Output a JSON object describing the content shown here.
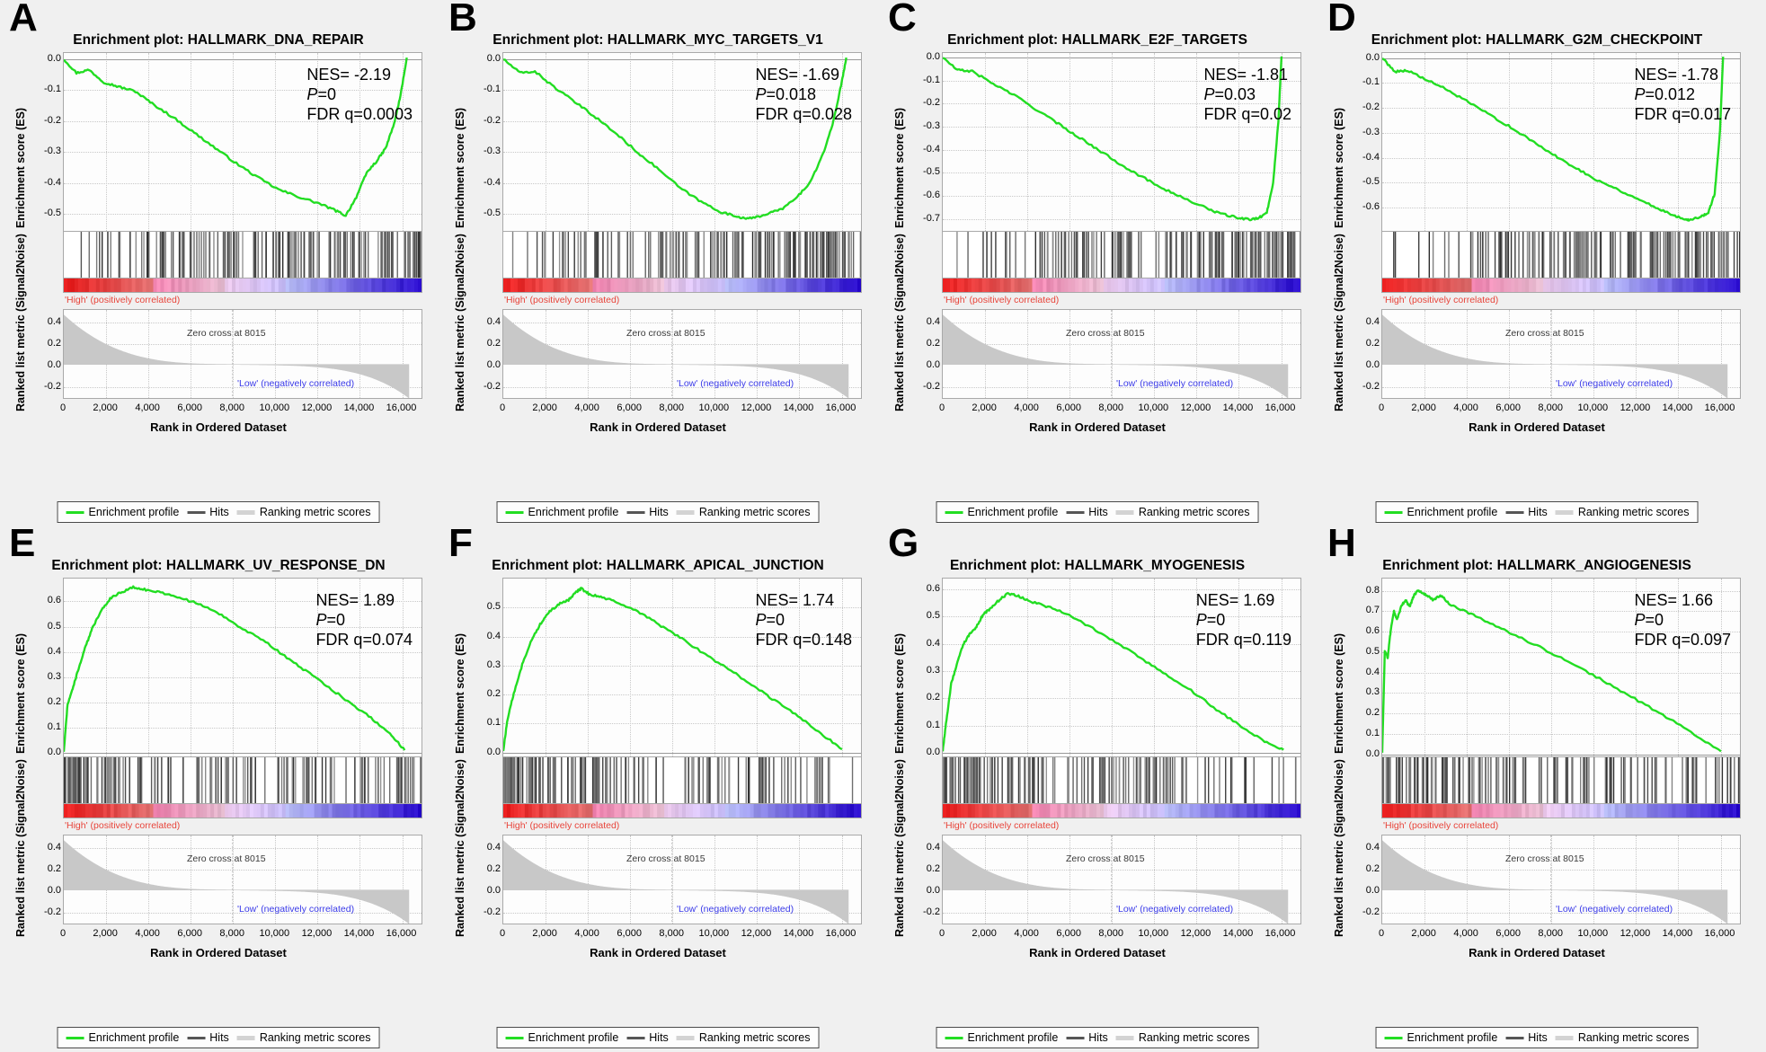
{
  "figure": {
    "background": "#f0f0f0",
    "curve_color": "#22dd22",
    "rank_fill": "#c8c8c8",
    "high_color": "#e8443a",
    "low_color": "#3a3ae8",
    "rows": 2,
    "cols": 4
  },
  "common": {
    "title_prefix": "Enrichment plot: ",
    "ylabel_es": "Enrichment score (ES)",
    "ylabel_rank": "Ranked list metric (Signal2Noise)",
    "xlabel": "Rank in Ordered Dataset",
    "high_label": "'High' (positively correlated)",
    "low_label": "'Low' (negatively correlated)",
    "zero_cross_label": "Zero cross at 8015",
    "zero_cross_rank": 8015,
    "xticks": [
      "0",
      "2,000",
      "4,000",
      "6,000",
      "8,000",
      "10,000",
      "12,000",
      "14,000",
      "16,000"
    ],
    "xtick_values": [
      0,
      2000,
      4000,
      6000,
      8000,
      10000,
      12000,
      14000,
      16000
    ],
    "xlim": [
      0,
      17000
    ],
    "metric_yticks": [
      "0.4",
      "0.2",
      "0.0",
      "-0.2"
    ],
    "metric_ylim": [
      -0.32,
      0.52
    ],
    "legend": {
      "enrichment_profile": "Enrichment profile",
      "hits": "Hits",
      "ranking_metric_scores": "Ranking metric scores"
    }
  },
  "panels": [
    {
      "letter": "A",
      "gene_set": "HALLMARK_DNA_REPAIR",
      "title": "Enrichment plot: HALLMARK_DNA_REPAIR",
      "nes_label": "NES= -2.19",
      "p_prefix": "P",
      "p_label": "=0",
      "fdr_label": "FDR q=0.0003",
      "nes": -2.19,
      "pvalue": 0,
      "fdr_q": 0.0003,
      "direction": "negative",
      "es_yticks": [
        "0.0",
        "-0.1",
        "-0.2",
        "-0.3",
        "-0.4",
        "-0.5"
      ],
      "es_ylim": [
        -0.56,
        0.02
      ],
      "peak_es": -0.51,
      "peak_rank": 13400,
      "chart_data": {
        "type": "line",
        "title": "Enrichment plot: HALLMARK_DNA_REPAIR",
        "xlabel": "Rank in Ordered Dataset",
        "ylabel": "Enrichment score (ES)",
        "xlim": [
          0,
          17000
        ],
        "ylim": [
          -0.56,
          0.02
        ],
        "grid": true,
        "x": [
          0,
          600,
          1200,
          1900,
          2600,
          3400,
          4200,
          5200,
          6200,
          7200,
          8200,
          9200,
          10200,
          11200,
          12100,
          12800,
          13400,
          13900,
          14400,
          14900,
          15300,
          15700,
          16000,
          16300
        ],
        "y": [
          0.0,
          -0.045,
          -0.035,
          -0.075,
          -0.09,
          -0.105,
          -0.145,
          -0.19,
          -0.24,
          -0.29,
          -0.34,
          -0.385,
          -0.425,
          -0.45,
          -0.47,
          -0.49,
          -0.51,
          -0.45,
          -0.37,
          -0.33,
          -0.29,
          -0.21,
          -0.12,
          0.005
        ]
      }
    },
    {
      "letter": "B",
      "gene_set": "HALLMARK_MYC_TARGETS_V1",
      "title": "Enrichment plot: HALLMARK_MYC_TARGETS_V1",
      "nes_label": "NES= -1.69",
      "p_prefix": "P",
      "p_label": "=0.018",
      "fdr_label": "FDR q=0.028",
      "nes": -1.69,
      "pvalue": 0.018,
      "fdr_q": 0.028,
      "direction": "negative",
      "es_yticks": [
        "0.0",
        "-0.1",
        "-0.2",
        "-0.3",
        "-0.4",
        "-0.5"
      ],
      "es_ylim": [
        -0.56,
        0.02
      ],
      "peak_es": -0.52,
      "peak_rank": 11800,
      "chart_data": {
        "type": "line",
        "title": "Enrichment plot: HALLMARK_MYC_TARGETS_V1",
        "xlabel": "Rank in Ordered Dataset",
        "ylabel": "Enrichment score (ES)",
        "xlim": [
          0,
          17000
        ],
        "ylim": [
          -0.56,
          0.02
        ],
        "grid": true,
        "x": [
          0,
          800,
          1500,
          2400,
          3400,
          4400,
          5400,
          6400,
          7400,
          8400,
          9400,
          10400,
          11200,
          11800,
          12500,
          13200,
          13900,
          14600,
          15200,
          15700,
          16100,
          16300
        ],
        "y": [
          0.0,
          -0.045,
          -0.04,
          -0.09,
          -0.14,
          -0.19,
          -0.245,
          -0.305,
          -0.36,
          -0.42,
          -0.465,
          -0.5,
          -0.515,
          -0.52,
          -0.505,
          -0.49,
          -0.455,
          -0.4,
          -0.31,
          -0.2,
          -0.07,
          0.005
        ]
      }
    },
    {
      "letter": "C",
      "gene_set": "HALLMARK_E2F_TARGETS",
      "title": "Enrichment plot: HALLMARK_E2F_TARGETS",
      "nes_label": "NES= -1.81",
      "p_prefix": "P",
      "p_label": "=0.03",
      "fdr_label": "FDR q=0.02",
      "nes": -1.81,
      "pvalue": 0.03,
      "fdr_q": 0.02,
      "direction": "negative",
      "es_yticks": [
        "0.0",
        "-0.1",
        "-0.2",
        "-0.3",
        "-0.4",
        "-0.5",
        "-0.6",
        "-0.7"
      ],
      "es_ylim": [
        -0.76,
        0.02
      ],
      "peak_es": -0.71,
      "peak_rank": 14500,
      "chart_data": {
        "type": "line",
        "title": "Enrichment plot: HALLMARK_E2F_TARGETS",
        "xlabel": "Rank in Ordered Dataset",
        "ylabel": "Enrichment score (ES)",
        "xlim": [
          0,
          17000
        ],
        "ylim": [
          -0.76,
          0.02
        ],
        "grid": true,
        "x": [
          0,
          700,
          1400,
          2400,
          3400,
          4400,
          5400,
          6400,
          7400,
          8400,
          9400,
          10400,
          11400,
          12400,
          13200,
          13900,
          14500,
          15000,
          15400,
          15700,
          15950,
          16100
        ],
        "y": [
          0.0,
          -0.055,
          -0.06,
          -0.115,
          -0.165,
          -0.225,
          -0.285,
          -0.345,
          -0.405,
          -0.465,
          -0.52,
          -0.57,
          -0.615,
          -0.655,
          -0.685,
          -0.7,
          -0.71,
          -0.705,
          -0.68,
          -0.55,
          -0.28,
          0.005
        ]
      }
    },
    {
      "letter": "D",
      "gene_set": "HALLMARK_G2M_CHECKPOINT",
      "title": "Enrichment plot: HALLMARK_G2M_CHECKPOINT",
      "nes_label": "NES= -1.78",
      "p_prefix": "P",
      "p_label": "=0.012",
      "fdr_label": "FDR q=0.017",
      "nes": -1.78,
      "pvalue": 0.012,
      "fdr_q": 0.017,
      "direction": "negative",
      "es_yticks": [
        "0.0",
        "-0.1",
        "-0.2",
        "-0.3",
        "-0.4",
        "-0.5",
        "-0.6"
      ],
      "es_ylim": [
        -0.7,
        0.02
      ],
      "peak_es": -0.655,
      "peak_rank": 14600,
      "chart_data": {
        "type": "line",
        "title": "Enrichment plot: HALLMARK_G2M_CHECKPOINT",
        "xlabel": "Rank in Ordered Dataset",
        "ylabel": "Enrichment score (ES)",
        "xlim": [
          0,
          17000
        ],
        "ylim": [
          -0.7,
          0.02
        ],
        "grid": true,
        "x": [
          0,
          600,
          1200,
          2000,
          3000,
          4000,
          5000,
          6000,
          7000,
          8000,
          9000,
          10000,
          11000,
          12000,
          13000,
          13800,
          14300,
          14600,
          15100,
          15500,
          15800,
          16050,
          16200
        ],
        "y": [
          0.0,
          -0.055,
          -0.05,
          -0.085,
          -0.125,
          -0.175,
          -0.225,
          -0.275,
          -0.33,
          -0.385,
          -0.435,
          -0.485,
          -0.525,
          -0.565,
          -0.605,
          -0.635,
          -0.65,
          -0.655,
          -0.645,
          -0.625,
          -0.55,
          -0.3,
          0.005
        ]
      }
    },
    {
      "letter": "E",
      "gene_set": "HALLMARK_UV_RESPONSE_DN",
      "title": "Enrichment plot: HALLMARK_UV_RESPONSE_DN",
      "nes_label": "NES= 1.89",
      "p_prefix": "P",
      "p_label": "=0",
      "fdr_label": "FDR q=0.074",
      "nes": 1.89,
      "pvalue": 0,
      "fdr_q": 0.074,
      "direction": "positive",
      "es_yticks": [
        "0.6",
        "0.5",
        "0.4",
        "0.3",
        "0.2",
        "0.1",
        "0.0"
      ],
      "es_ylim": [
        -0.02,
        0.69
      ],
      "peak_es": 0.655,
      "peak_rank": 3300,
      "chart_data": {
        "type": "line",
        "title": "Enrichment plot: HALLMARK_UV_RESPONSE_DN",
        "xlabel": "Rank in Ordered Dataset",
        "ylabel": "Enrichment score (ES)",
        "xlim": [
          0,
          17000
        ],
        "ylim": [
          -0.02,
          0.69
        ],
        "grid": true,
        "x": [
          0,
          180,
          420,
          700,
          1000,
          1350,
          1750,
          2200,
          2700,
          3300,
          3900,
          4600,
          5500,
          6500,
          7500,
          8500,
          9600,
          10600,
          11600,
          12600,
          13600,
          14600,
          15500,
          16200
        ],
        "y": [
          0.0,
          0.19,
          0.25,
          0.33,
          0.41,
          0.49,
          0.56,
          0.61,
          0.635,
          0.655,
          0.645,
          0.635,
          0.615,
          0.585,
          0.545,
          0.49,
          0.435,
          0.375,
          0.315,
          0.255,
          0.195,
          0.135,
          0.07,
          0.005
        ]
      }
    },
    {
      "letter": "F",
      "gene_set": "HALLMARK_APICAL_JUNCTION",
      "title": "Enrichment plot: HALLMARK_APICAL_JUNCTION",
      "nes_label": "NES= 1.74",
      "p_prefix": "P",
      "p_label": "=0",
      "fdr_label": "FDR q=0.148",
      "nes": 1.74,
      "pvalue": 0,
      "fdr_q": 0.148,
      "direction": "positive",
      "es_yticks": [
        "0.5",
        "0.4",
        "0.3",
        "0.2",
        "0.1",
        "0.0"
      ],
      "es_ylim": [
        -0.02,
        0.6
      ],
      "peak_es": 0.56,
      "peak_rank": 3700,
      "chart_data": {
        "type": "line",
        "title": "Enrichment plot: HALLMARK_APICAL_JUNCTION",
        "xlabel": "Rank in Ordered Dataset",
        "ylabel": "Enrichment score (ES)",
        "xlim": [
          0,
          17000
        ],
        "ylim": [
          -0.02,
          0.6
        ],
        "grid": true,
        "x": [
          0,
          200,
          500,
          900,
          1300,
          1750,
          2200,
          2700,
          3100,
          3500,
          3700,
          4100,
          4700,
          5500,
          6500,
          7500,
          8500,
          9600,
          10700,
          11800,
          12900,
          14000,
          15100,
          16100
        ],
        "y": [
          0.0,
          0.11,
          0.2,
          0.3,
          0.38,
          0.44,
          0.485,
          0.515,
          0.525,
          0.555,
          0.565,
          0.545,
          0.535,
          0.515,
          0.48,
          0.435,
          0.39,
          0.335,
          0.285,
          0.23,
          0.175,
          0.12,
          0.06,
          0.005
        ]
      }
    },
    {
      "letter": "G",
      "gene_set": "HALLMARK_MYOGENESIS",
      "title": "Enrichment plot: HALLMARK_MYOGENESIS",
      "nes_label": "NES= 1.69",
      "p_prefix": "P",
      "p_label": "=0",
      "fdr_label": "FDR q=0.119",
      "nes": 1.69,
      "pvalue": 0,
      "fdr_q": 0.119,
      "direction": "positive",
      "es_yticks": [
        "0.6",
        "0.5",
        "0.4",
        "0.3",
        "0.2",
        "0.1",
        "0.0"
      ],
      "es_ylim": [
        -0.02,
        0.64
      ],
      "peak_es": 0.585,
      "peak_rank": 3100,
      "chart_data": {
        "type": "line",
        "title": "Enrichment plot: HALLMARK_MYOGENESIS",
        "xlabel": "Rank in Ordered Dataset",
        "ylabel": "Enrichment score (ES)",
        "xlim": [
          0,
          17000
        ],
        "ylim": [
          -0.02,
          0.64
        ],
        "grid": true,
        "x": [
          0,
          150,
          400,
          700,
          1000,
          1300,
          1600,
          1900,
          2200,
          2600,
          3100,
          3600,
          4200,
          5000,
          6000,
          7000,
          8200,
          9400,
          10600,
          11800,
          13000,
          14200,
          15300,
          16200
        ],
        "y": [
          0.0,
          0.1,
          0.25,
          0.33,
          0.4,
          0.435,
          0.46,
          0.505,
          0.525,
          0.555,
          0.585,
          0.575,
          0.555,
          0.535,
          0.505,
          0.46,
          0.405,
          0.345,
          0.285,
          0.225,
          0.155,
          0.09,
          0.035,
          0.005
        ]
      }
    },
    {
      "letter": "H",
      "gene_set": "HALLMARK_ANGIOGENESIS",
      "title": "Enrichment plot: HALLMARK_ANGIOGENESIS",
      "nes_label": "NES= 1.66",
      "p_prefix": "P",
      "p_label": "=0",
      "fdr_label": "FDR q=0.097",
      "nes": 1.66,
      "pvalue": 0,
      "fdr_q": 0.097,
      "direction": "positive",
      "es_yticks": [
        "0.8",
        "0.7",
        "0.6",
        "0.5",
        "0.4",
        "0.3",
        "0.2",
        "0.1",
        "0.0"
      ],
      "es_ylim": [
        -0.02,
        0.86
      ],
      "peak_es": 0.8,
      "peak_rank": 1700,
      "chart_data": {
        "type": "line",
        "title": "Enrichment plot: HALLMARK_ANGIOGENESIS",
        "xlabel": "Rank in Ordered Dataset",
        "ylabel": "Enrichment score (ES)",
        "xlim": [
          0,
          17000
        ],
        "ylim": [
          -0.02,
          0.86
        ],
        "grid": true,
        "x": [
          0,
          120,
          260,
          400,
          560,
          700,
          900,
          1100,
          1300,
          1500,
          1700,
          2000,
          2400,
          2800,
          3200,
          4000,
          5000,
          6200,
          7500,
          9000,
          10500,
          12000,
          13500,
          15000,
          16100
        ],
        "y": [
          0.0,
          0.5,
          0.47,
          0.6,
          0.7,
          0.655,
          0.72,
          0.755,
          0.72,
          0.775,
          0.8,
          0.785,
          0.755,
          0.775,
          0.735,
          0.695,
          0.645,
          0.585,
          0.52,
          0.44,
          0.355,
          0.265,
          0.175,
          0.08,
          0.005
        ]
      }
    }
  ]
}
